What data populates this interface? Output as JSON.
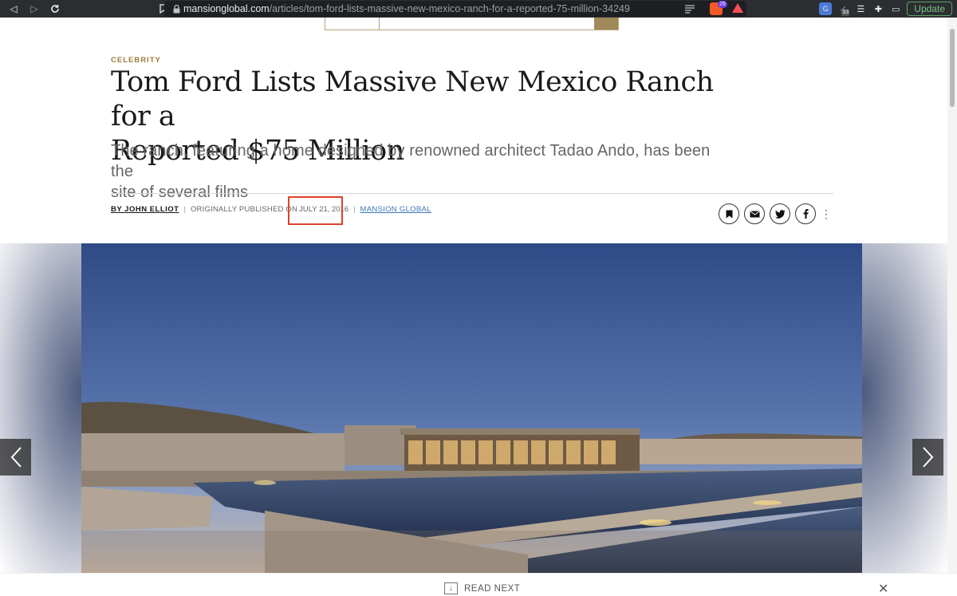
{
  "browser": {
    "url_host": "mansionglobal.com",
    "url_path": "/articles/tom-ford-lists-massive-new-mexico-ranch-for-a-reported-75-million-34249",
    "brave_count": "29",
    "ext_count": "33",
    "update_label": "Update"
  },
  "article": {
    "kicker": "CELEBRITY",
    "headline_line1": "Tom Ford Lists Massive New Mexico Ranch for a",
    "headline_line2": "Reported $75 Million",
    "dek_line1": "The ranch, featuring a home designed by renowned architect Tadao Ando, has been the",
    "dek_line2": "site of several films",
    "author": "BY JOHN ELLIOT",
    "separator": "|",
    "published_prefix": "ORIGINALLY PUBLISHED ON",
    "date": "JULY 21, 2016",
    "source": "MANSION GLOBAL"
  },
  "readnext": {
    "label": "READ NEXT"
  },
  "icons": [
    "back-icon",
    "forward-icon",
    "reload-icon",
    "bookmark-icon",
    "lock-icon",
    "reader-icon",
    "brave-shield-icon",
    "rewards-icon",
    "translate-icon",
    "extension-icon",
    "list-icon",
    "puzzle-icon",
    "wallet-icon",
    "save-icon",
    "email-icon",
    "twitter-icon",
    "facebook-icon",
    "more-icon",
    "chevron-left-icon",
    "chevron-right-icon",
    "download-arrow-icon",
    "close-icon"
  ],
  "colors": {
    "kicker": "#9b7c3c",
    "source_link": "#3a77b7",
    "highlight": "#e0412c",
    "update": "#7cc38a"
  }
}
